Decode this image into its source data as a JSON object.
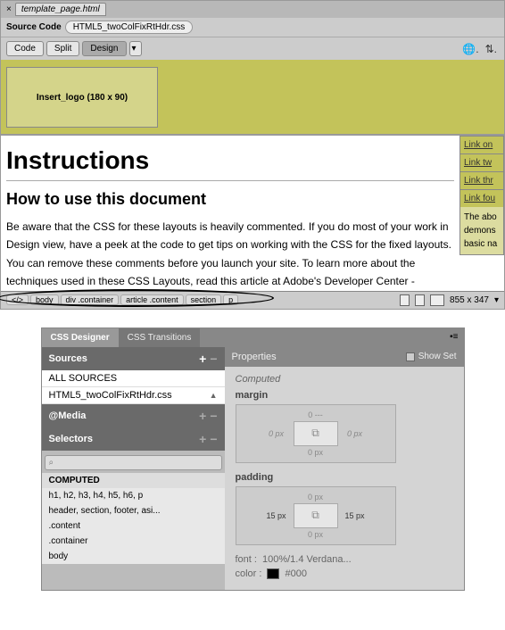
{
  "tab_title": "template_page.html",
  "source_btn": "Source Code",
  "related_file": "HTML5_twoColFixRtHdr.css",
  "view_modes": {
    "code": "Code",
    "split": "Split",
    "design": "Design"
  },
  "logo_text": "Insert_logo (180 x 90)",
  "doc": {
    "h1": "Instructions",
    "h2": "How to use this document",
    "para": "Be aware that the CSS for these layouts is heavily commented. If you do most of your work in Design view, have a peek at the code to get tips on working with the CSS for the fixed layouts. You can remove these comments before you launch your site. To learn more about the techniques used in these CSS Layouts, read this article at Adobe's Developer Center -"
  },
  "sidebar_links": [
    "Link on",
    "Link tw",
    "Link thr",
    "Link fou"
  ],
  "sidebar_text": "The abo\ndemons\nbasic na",
  "breadcrumbs": [
    "body",
    "div .container",
    "article .content",
    "section",
    "p"
  ],
  "doc_size": "855 x 347",
  "panel": {
    "tabs": [
      "CSS Designer",
      "CSS Transitions"
    ],
    "sources_hdr": "Sources",
    "sources": [
      "ALL SOURCES",
      "HTML5_twoColFixRtHdr.css"
    ],
    "media_hdr": "@Media",
    "selectors_hdr": "Selectors",
    "computed_lbl": "COMPUTED",
    "selectors": [
      "h1, h2, h3, h4, h5, h6, p",
      "header, section, footer, asi...",
      ".content",
      ".container",
      "body"
    ],
    "props_hdr": "Properties",
    "show_set": "Show Set",
    "computed_cat": "Computed",
    "margin_lbl": "margin",
    "margin": {
      "top": "0 ---",
      "right": "0 px",
      "bottom": "0 px",
      "left": "0 px"
    },
    "padding_lbl": "padding",
    "padding": {
      "top": "0 px",
      "right": "15 px",
      "bottom": "0 px",
      "left": "15 px"
    },
    "font_lbl": "font  :",
    "font_val": "100%/1.4 Verdana...",
    "color_lbl": "color  :",
    "color_val": "#000"
  }
}
